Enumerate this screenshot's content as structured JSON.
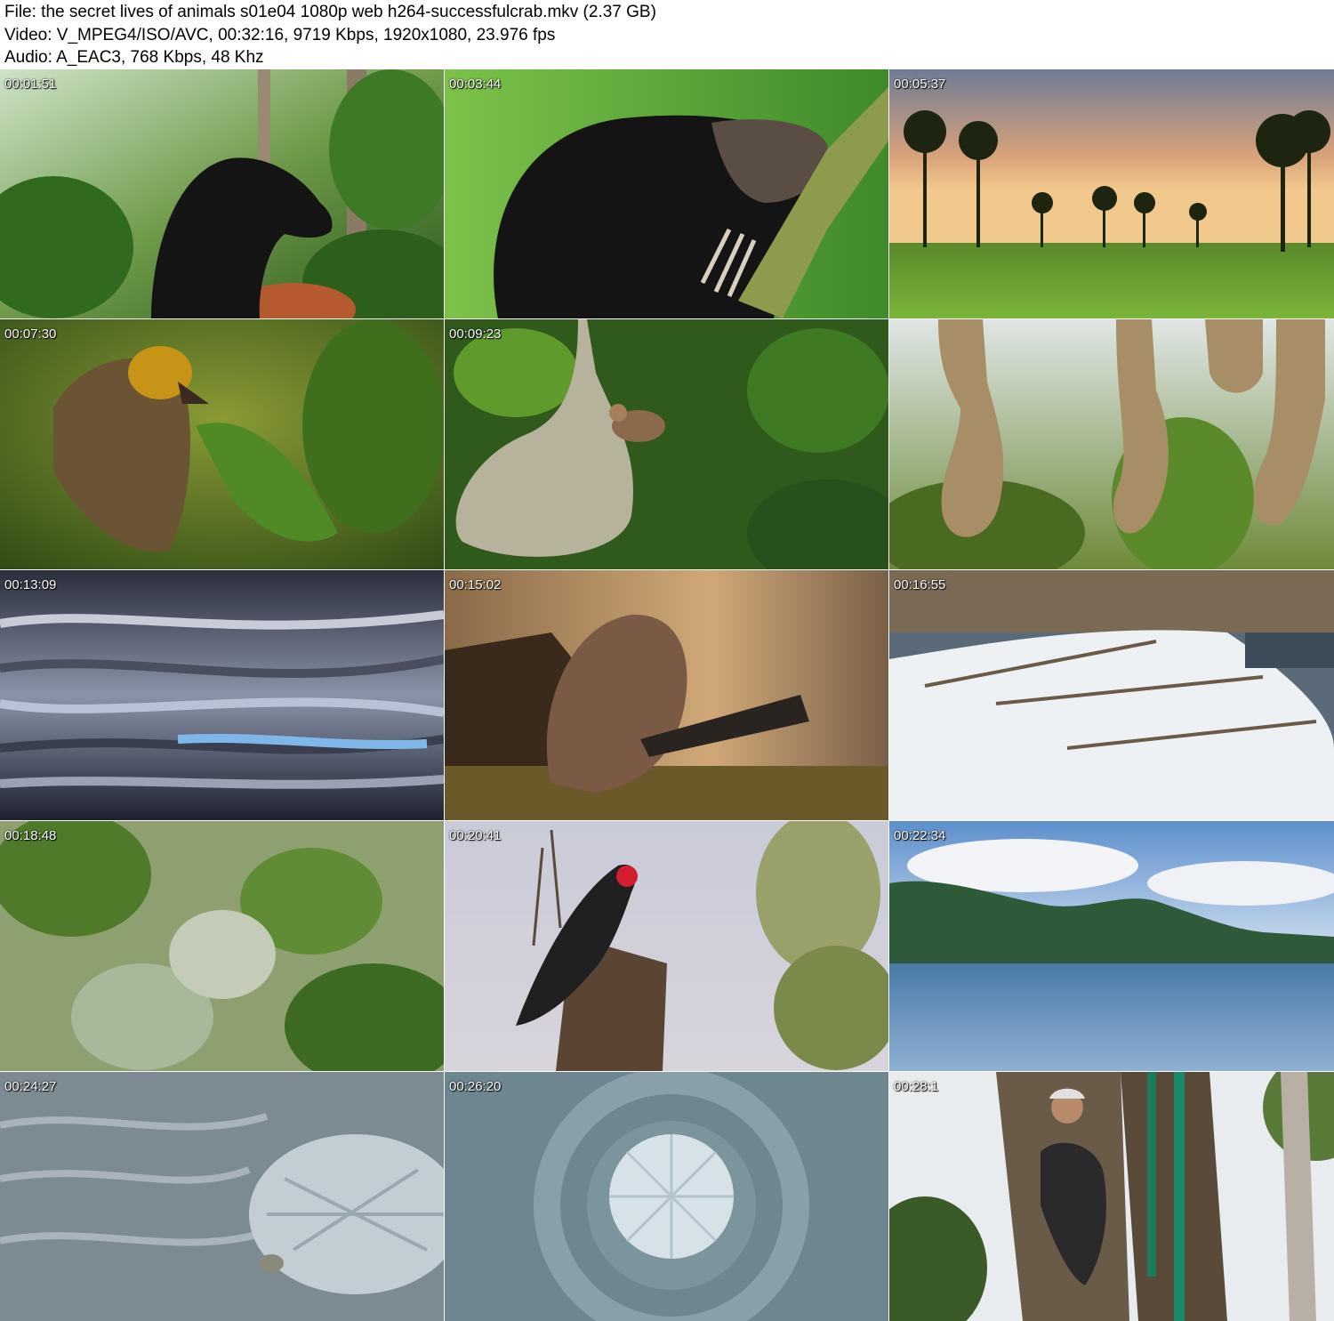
{
  "file_info": {
    "file_line": "File: the secret lives of animals s01e04 1080p web h264-successfulcrab.mkv (2.37 GB)",
    "video_line": "Video: V_MPEG4/ISO/AVC, 00:32:16, 9719 Kbps, 1920x1080, 23.976 fps",
    "audio_line": "Audio: A_EAC3, 768 Kbps, 48 Khz"
  },
  "thumbnails": [
    {
      "timestamp": "00:01:51",
      "scene": "sun-bear-forest-image"
    },
    {
      "timestamp": "00:03:44",
      "scene": "sun-bear-closeup-image"
    },
    {
      "timestamp": "00:05:37",
      "scene": "palm-field-sunset-image"
    },
    {
      "timestamp": "00:07:30",
      "scene": "weaver-bird-leaf-image"
    },
    {
      "timestamp": "00:09:23",
      "scene": "weaver-nest-image"
    },
    {
      "timestamp": "",
      "scene": "hanging-nests-image"
    },
    {
      "timestamp": "00:13:09",
      "scene": "water-ripples-image"
    },
    {
      "timestamp": "00:15:02",
      "scene": "beaver-image"
    },
    {
      "timestamp": "00:16:55",
      "scene": "snowy-beaver-lodge-image"
    },
    {
      "timestamp": "00:18:48",
      "scene": "blurred-foliage-image"
    },
    {
      "timestamp": "00:20:41",
      "scene": "palm-cockatoo-image"
    },
    {
      "timestamp": "00:22:34",
      "scene": "coastal-mountains-image"
    },
    {
      "timestamp": "00:24:27",
      "scene": "sand-ripples-pufferfish-image"
    },
    {
      "timestamp": "00:26:20",
      "scene": "pufferfish-sand-circle-image"
    },
    {
      "timestamp": "00:28:1",
      "scene": "tree-climber-image"
    }
  ]
}
